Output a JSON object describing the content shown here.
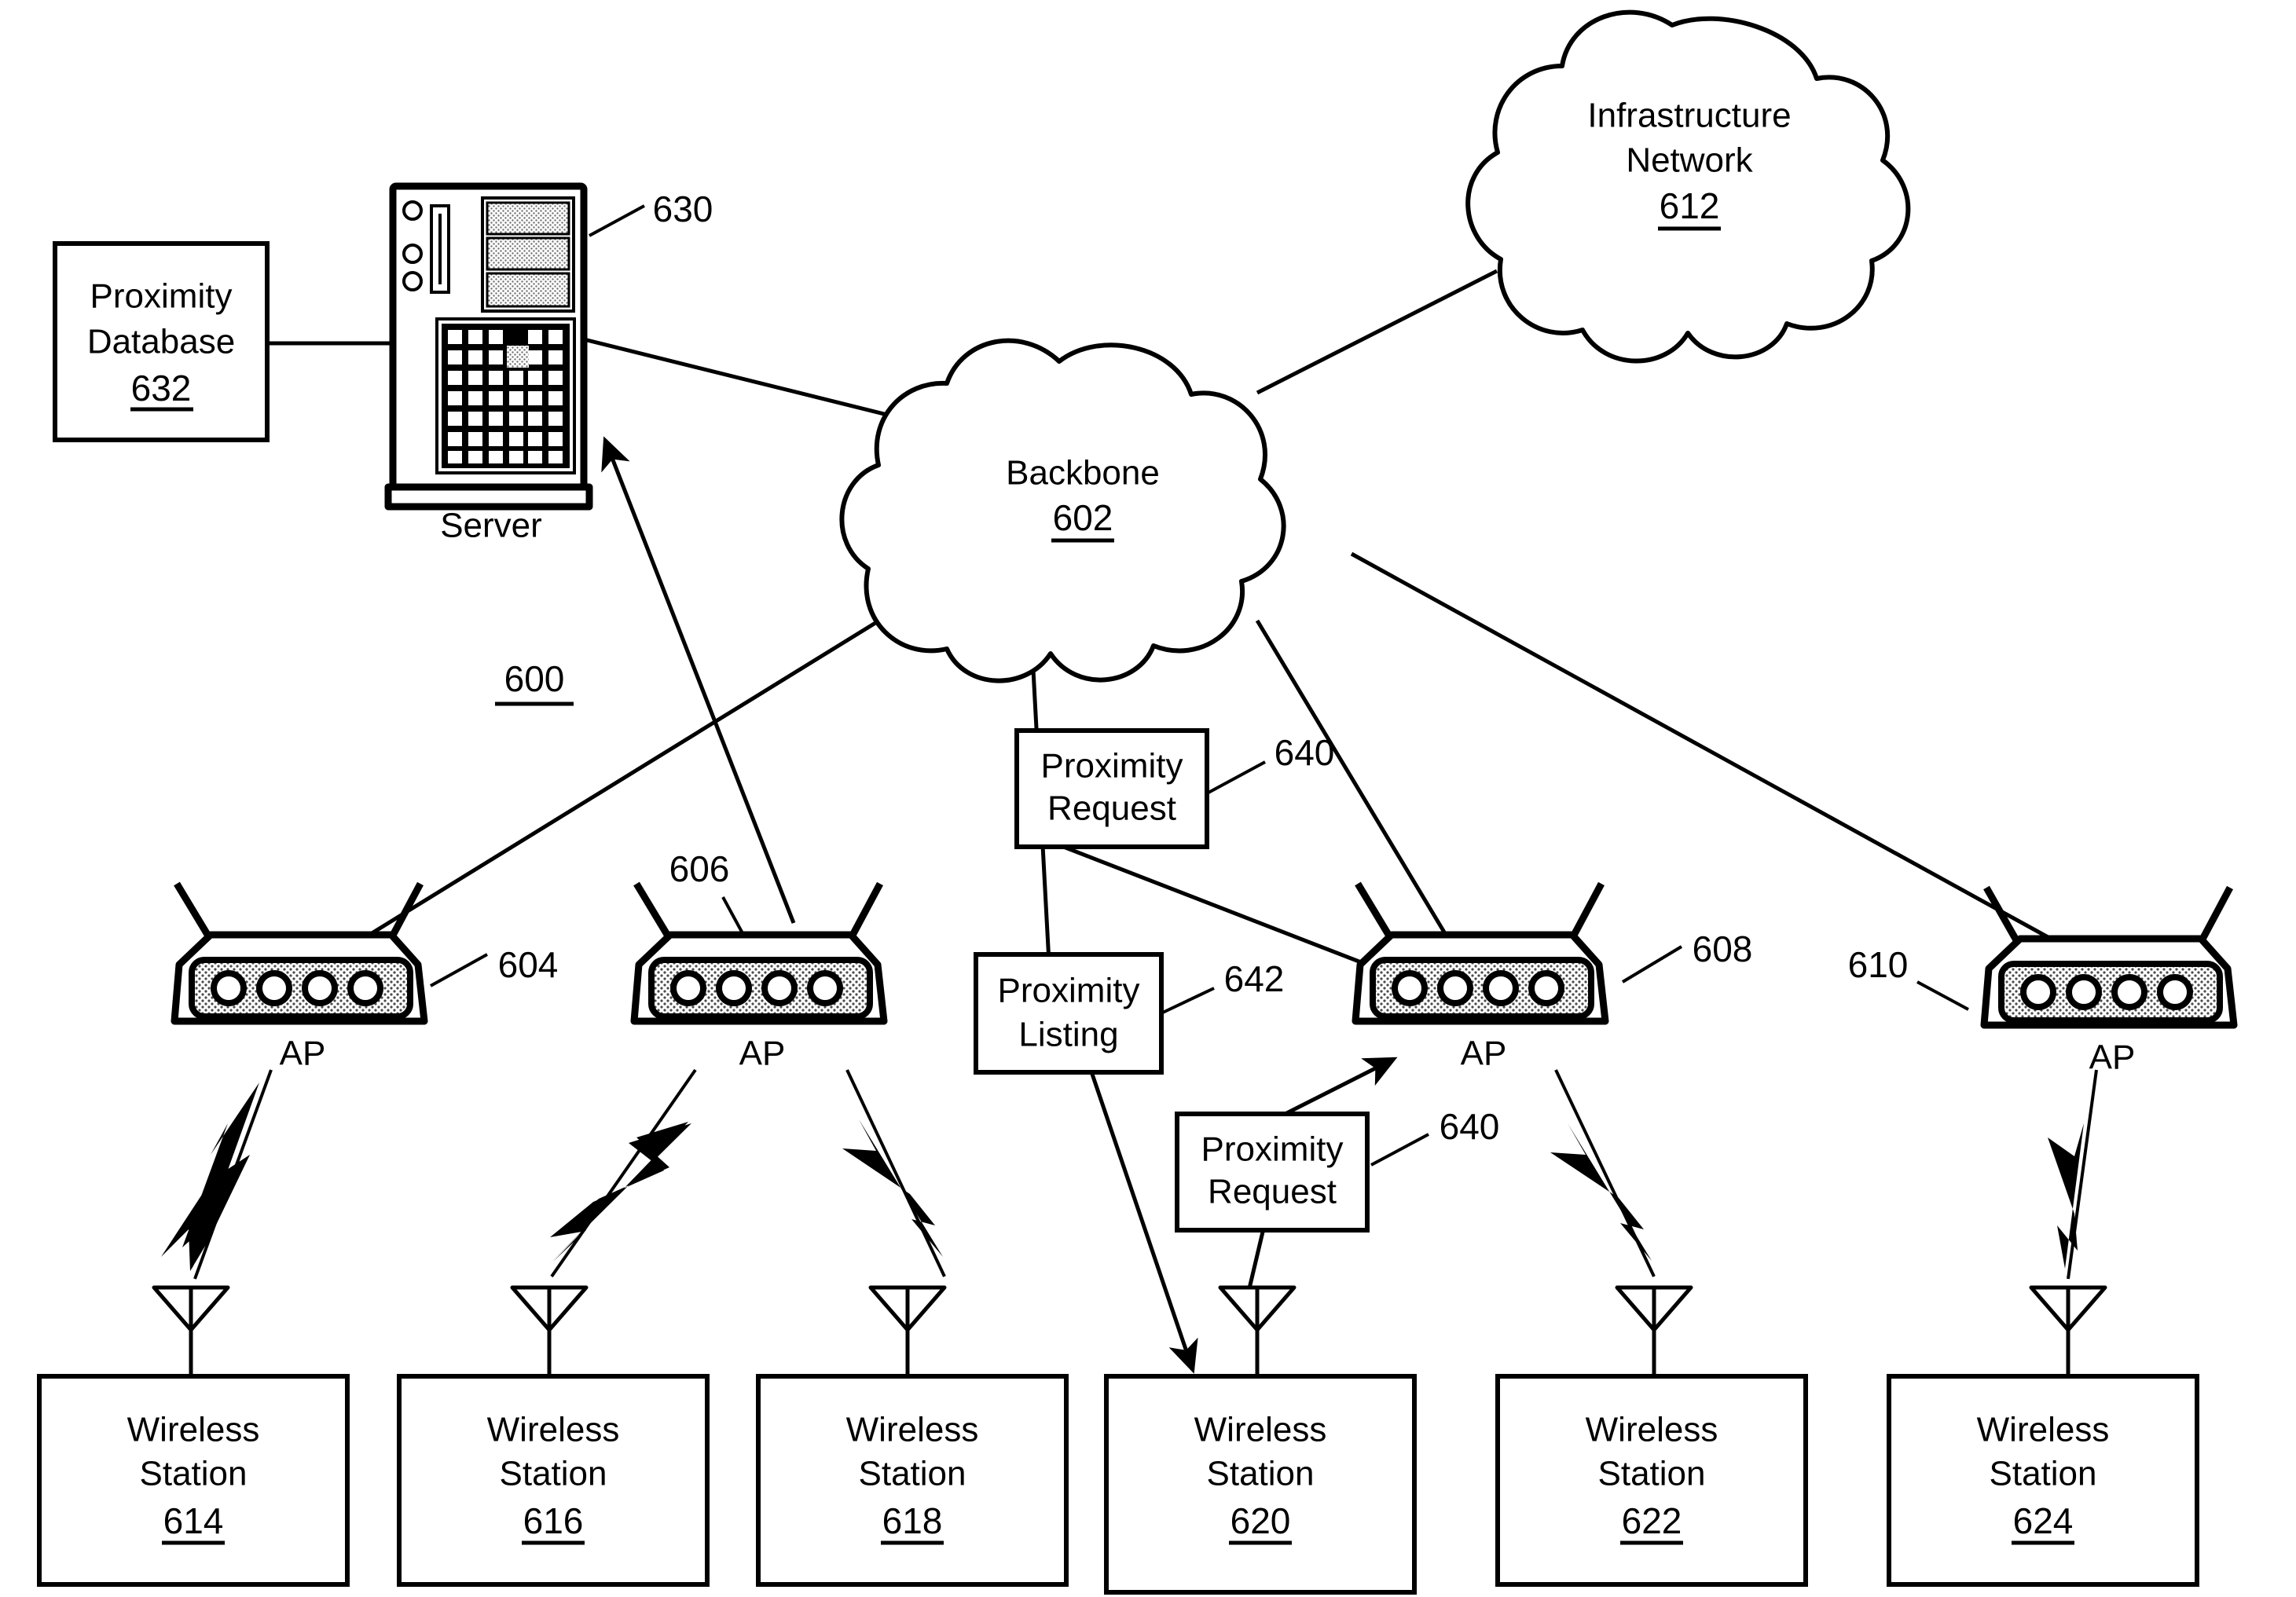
{
  "figure": {
    "number": "600",
    "title_note": "Wireless network proximity system patent figure"
  },
  "clouds": [
    {
      "id": "backbone",
      "name": "Backbone",
      "ref": "602"
    },
    {
      "id": "infrastructure",
      "name_line1": "Infrastructure",
      "name_line2": "Network",
      "ref": "612"
    }
  ],
  "server": {
    "caption": "Server",
    "ref": "630"
  },
  "database": {
    "line1": "Proximity",
    "line2": "Database",
    "ref": "632"
  },
  "access_points": [
    {
      "label": "AP",
      "ref": "604"
    },
    {
      "label": "AP",
      "ref": "606"
    },
    {
      "label": "AP",
      "ref": "608"
    },
    {
      "label": "AP",
      "ref": "610"
    }
  ],
  "stations": [
    {
      "line1": "Wireless",
      "line2": "Station",
      "ref": "614"
    },
    {
      "line1": "Wireless",
      "line2": "Station",
      "ref": "616"
    },
    {
      "line1": "Wireless",
      "line2": "Station",
      "ref": "618"
    },
    {
      "line1": "Wireless",
      "line2": "Station",
      "ref": "620"
    },
    {
      "line1": "Wireless",
      "line2": "Station",
      "ref": "622"
    },
    {
      "line1": "Wireless",
      "line2": "Station",
      "ref": "624"
    }
  ],
  "messages": [
    {
      "id": "proximity-request-upper",
      "line1": "Proximity",
      "line2": "Request",
      "ref": "640"
    },
    {
      "id": "proximity-listing",
      "line1": "Proximity",
      "line2": "Listing",
      "ref": "642"
    },
    {
      "id": "proximity-request-lower",
      "line1": "Proximity",
      "line2": "Request",
      "ref": "640"
    }
  ],
  "colors": {
    "ink": "#000000",
    "paper": "#ffffff",
    "device_fill_tint": "#d8d8d8"
  }
}
